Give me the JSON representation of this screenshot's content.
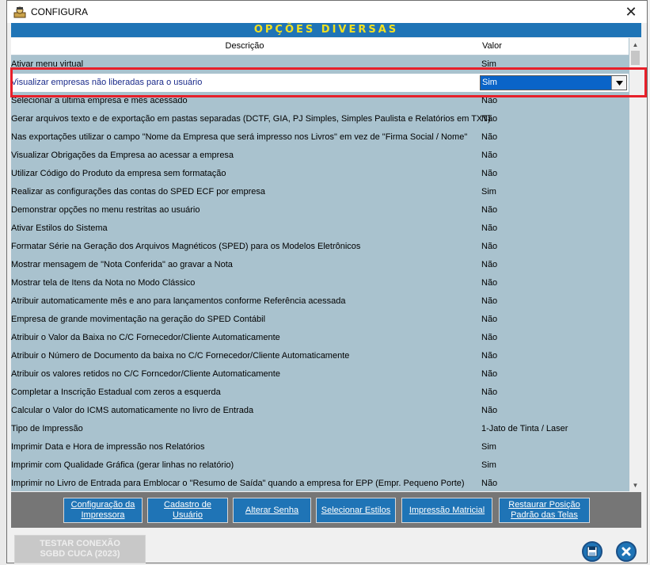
{
  "window": {
    "title": "CONFIGURA"
  },
  "banner": {
    "title": "OPÇÕES DIVERSAS"
  },
  "grid": {
    "headers": {
      "descricao": "Descrição",
      "valor": "Valor"
    },
    "rows": [
      {
        "desc": "Ativar menu virtual",
        "val": "Sim"
      },
      {
        "desc": "Visualizar empresas não liberadas para o usuário",
        "val": "Sim"
      },
      {
        "desc": "Selecionar a última empresa e mês acessado",
        "val": "Não"
      },
      {
        "desc": "Gerar arquivos texto e de exportação em pastas separadas (DCTF, GIA, PJ Simples, Simples Paulista e Relatórios em TXT)",
        "val": "Não"
      },
      {
        "desc": "Nas exportações utilizar o campo \"Nome da Empresa que será impresso nos Livros\" em vez de \"Firma Social / Nome\"",
        "val": "Não"
      },
      {
        "desc": "Visualizar Obrigações da Empresa ao acessar a empresa",
        "val": "Não"
      },
      {
        "desc": "Utilizar Código do Produto da empresa sem formatação",
        "val": "Não"
      },
      {
        "desc": "Realizar as configurações das contas do SPED ECF por empresa",
        "val": "Sim"
      },
      {
        "desc": "Demonstrar opções no menu restritas ao usuário",
        "val": "Não"
      },
      {
        "desc": "Ativar Estilos do Sistema",
        "val": "Não"
      },
      {
        "desc": "Formatar Série na Geração dos Arquivos Magnéticos (SPED) para os Modelos Eletrônicos",
        "val": "Não"
      },
      {
        "desc": "Mostrar mensagem de \"Nota Conferida\" ao gravar a Nota",
        "val": "Não"
      },
      {
        "desc": "Mostrar tela de Itens da Nota no Modo Clássico",
        "val": "Não"
      },
      {
        "desc": "Atribuir automaticamente mês e ano para lançamentos conforme Referência acessada",
        "val": "Não"
      },
      {
        "desc": "Empresa de grande movimentação na geração do SPED Contábil",
        "val": "Não"
      },
      {
        "desc": "Atribuir o Valor da Baixa no C/C Fornecedor/Cliente Automaticamente",
        "val": "Não"
      },
      {
        "desc": "Atribuir o Número de Documento da baixa no C/C Fornecedor/Cliente Automaticamente",
        "val": "Não"
      },
      {
        "desc": "Atribuir os valores retidos no C/C Forncedor/Cliente Automaticamente",
        "val": "Não"
      },
      {
        "desc": "Completar a Inscrição Estadual com zeros a esquerda",
        "val": "Não"
      },
      {
        "desc": "Calcular o Valor do ICMS automaticamente no livro de Entrada",
        "val": "Não"
      },
      {
        "desc": "Tipo de Impressão",
        "val": "1-Jato de Tinta / Laser"
      },
      {
        "desc": "Imprimir Data e Hora de impressão nos Relatórios",
        "val": "Sim"
      },
      {
        "desc": "Imprimir com Qualidade Gráfica (gerar linhas no relatório)",
        "val": "Sim"
      },
      {
        "desc": "Imprimir no Livro de Entrada para Emblocar o \"Resumo de Saída\" quando a empresa for EPP (Empr. Pequeno Porte)",
        "val": "Não"
      }
    ],
    "selected_index": 1
  },
  "buttons": {
    "config_impressora": {
      "l1": "Configuração da",
      "l2": "Impressora"
    },
    "cadastro_usuario": {
      "l1": "Cadastro de",
      "l2": "Usuário"
    },
    "alterar_senha": {
      "l1": "Alterar Senha"
    },
    "selecionar_estilos": {
      "l1": "Selecionar Estilos"
    },
    "impressao_matricial": {
      "l1": "Impressão Matricial"
    },
    "restaurar_posicao": {
      "l1": "Restaurar Posição",
      "l2": "Padrão das Telas"
    }
  },
  "test_connection": {
    "l1": "TESTAR CONEXÃO",
    "l2": "SGBD CUCA (2023)"
  },
  "colors": {
    "accent": "#1f74b6",
    "banner_text": "#f2e020",
    "grid_bg": "#a9c2ce",
    "highlight": "#e8202a"
  }
}
